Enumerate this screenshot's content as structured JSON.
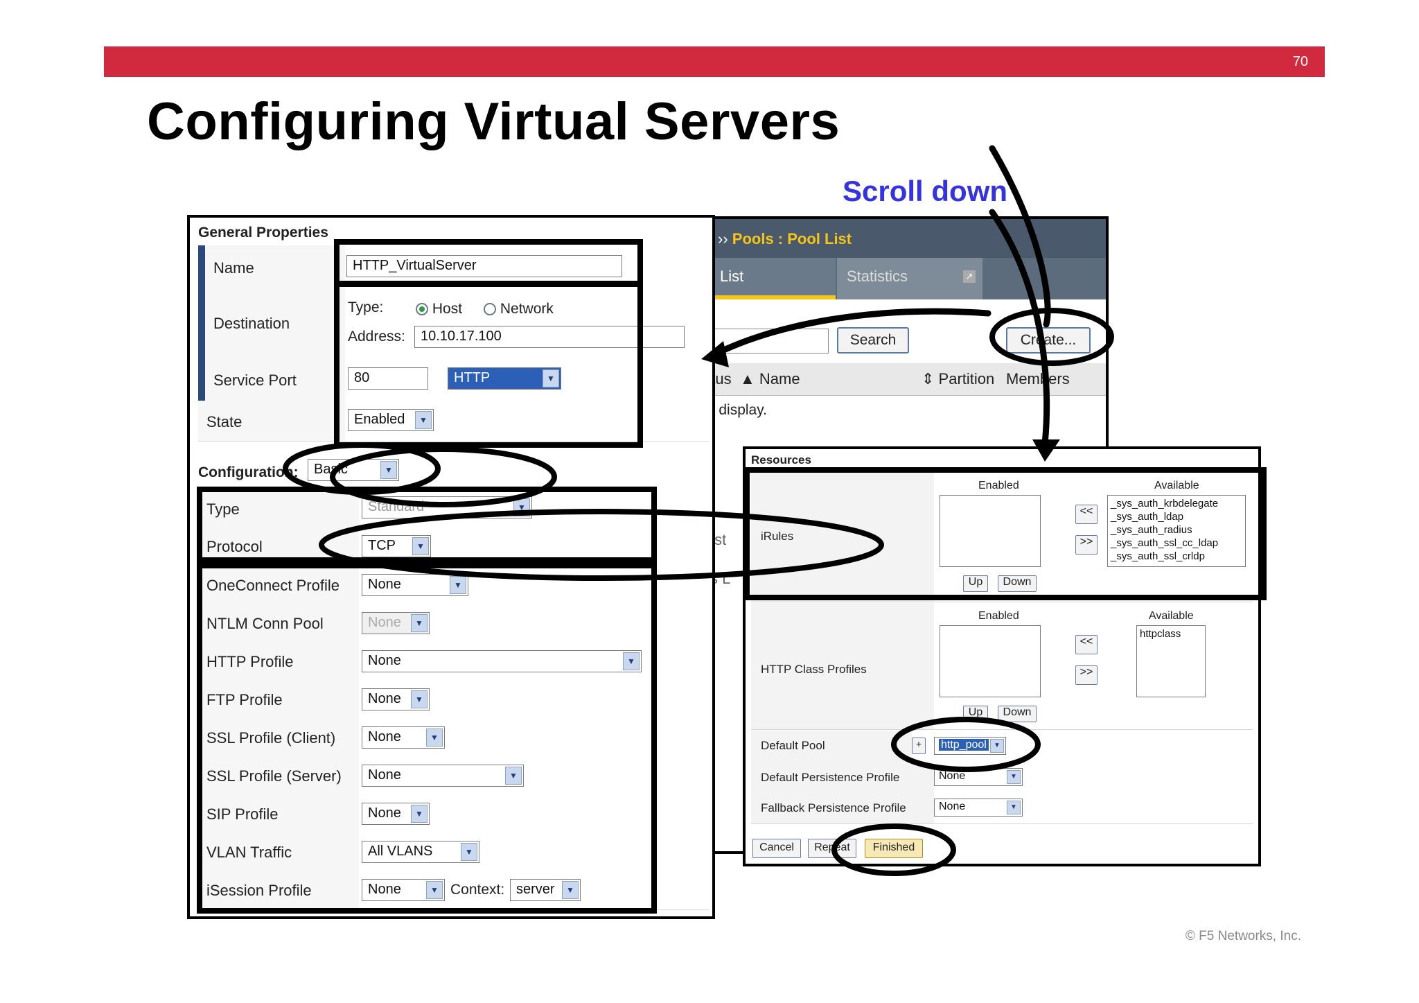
{
  "slide": {
    "page_number": "70",
    "title": "Configuring Virtual Servers",
    "callout": "Scroll down",
    "copyright": "© F5 Networks, Inc."
  },
  "pool_list": {
    "breadcrumb_prefix": "ic ››",
    "breadcrumb_link": "Pools : Pool List",
    "tab_active": "l List",
    "tab_statistics": "Statistics",
    "search_button": "Search",
    "create_button": "Create...",
    "col_status": "atus",
    "col_name": "▲ Name",
    "col_partition": "⇕ Partition",
    "col_members": "Members",
    "empty_message": "to display.",
    "fragment_1": "List",
    "fragment_2": "ss L"
  },
  "general_properties": {
    "heading": "General Properties",
    "name_label": "Name",
    "name_value": "HTTP_VirtualServer",
    "destination_label": "Destination",
    "type_label": "Type:",
    "host_option": "Host",
    "network_option": "Network",
    "selected_type": "Host",
    "address_label": "Address:",
    "address_value": "10.10.17.100",
    "service_port_label": "Service Port",
    "service_port_value": "80",
    "service_port_select": "HTTP",
    "state_label": "State",
    "state_value": "Enabled"
  },
  "configuration": {
    "heading": "Configuration:",
    "mode": "Basic",
    "rows": [
      {
        "label": "Type",
        "value": "Standard"
      },
      {
        "label": "Protocol",
        "value": "TCP"
      },
      {
        "label": "OneConnect Profile",
        "value": "None"
      },
      {
        "label": "NTLM Conn Pool",
        "value": "None"
      },
      {
        "label": "HTTP Profile",
        "value": "None"
      },
      {
        "label": "FTP Profile",
        "value": "None"
      },
      {
        "label": "SSL Profile (Client)",
        "value": "None"
      },
      {
        "label": "SSL Profile (Server)",
        "value": "None"
      },
      {
        "label": "SIP Profile",
        "value": "None"
      },
      {
        "label": "VLAN Traffic",
        "value": "All VLANS"
      },
      {
        "label": "iSession Profile",
        "value": "None"
      }
    ],
    "context_label": "Context:",
    "context_value": "server"
  },
  "resources": {
    "heading": "Resources",
    "irules_label": "iRules",
    "enabled_label": "Enabled",
    "available_label": "Available",
    "irules_available": [
      "_sys_auth_krbdelegate",
      "_sys_auth_ldap",
      "_sys_auth_radius",
      "_sys_auth_ssl_cc_ldap",
      "_sys_auth_ssl_crldp"
    ],
    "move_left": "<<",
    "move_right": ">>",
    "up_button": "Up",
    "down_button": "Down",
    "http_class_label": "HTTP Class Profiles",
    "http_class_available": [
      "httpclass"
    ],
    "default_pool_label": "Default Pool",
    "plus_button": "+",
    "default_pool_value": "http_pool",
    "default_persistence_label": "Default Persistence Profile",
    "default_persistence_value": "None",
    "fallback_persistence_label": "Fallback Persistence Profile",
    "fallback_persistence_value": "None",
    "cancel_button": "Cancel",
    "repeat_button": "Repeat",
    "finished_button": "Finished"
  },
  "colors": {
    "header_bar": "#d12a3e",
    "callout": "#3333e0",
    "nav_dark": "#4a5a6c",
    "highlight_select": "#2c5fb8"
  }
}
